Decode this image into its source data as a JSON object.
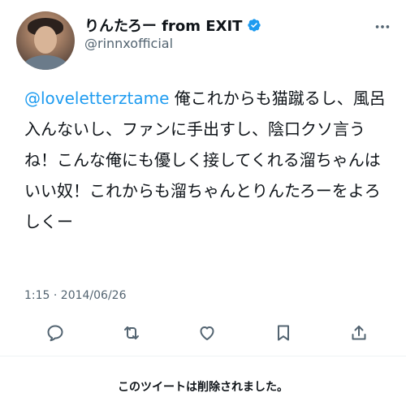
{
  "author": {
    "display_name": "りんたろー from EXIT",
    "handle": "@rinnxofficial",
    "verified": true,
    "avatar": "profile-photo"
  },
  "tweet": {
    "mention": "@loveletterztame",
    "body": " 俺これからも猫蹴るし、風呂入んないし、ファンに手出すし、陰口クソ言うね！こんな俺にも優しく接してくれる溜ちゃんはいい奴！これからも溜ちゃんとりんたろーをよろしくー",
    "timestamp": "1:15 · 2014/06/26"
  },
  "actions": {
    "reply": "reply-icon",
    "retweet": "retweet-icon",
    "like": "heart-icon",
    "bookmark": "bookmark-icon",
    "share": "share-icon"
  },
  "notice": {
    "deleted": "このツイートは削除されました。"
  },
  "colors": {
    "accent": "#1d9bf0",
    "text": "#0f1419",
    "secondary": "#536471"
  }
}
